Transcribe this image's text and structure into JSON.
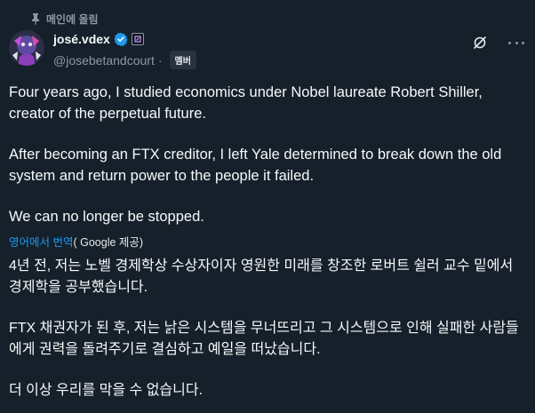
{
  "pinned": {
    "label": "메인에 올림",
    "icon": "pin-icon"
  },
  "author": {
    "display_name": "josé.vdex",
    "handle": "@josebetandcourt",
    "separator": "·",
    "member_badge": "멤버",
    "verified_color": "#1d9bf0"
  },
  "actions": {
    "grok_icon": "grok-icon",
    "more_icon": "more-icon"
  },
  "tweet": {
    "paragraphs": [
      "Four years ago, I studied economics under Nobel laureate Robert Shiller, creator of the perpetual future.",
      "After becoming an FTX creditor, I left Yale determined to break down the old system and return power to the people it failed.",
      "We can no longer be stopped."
    ]
  },
  "translation": {
    "link_label": "영어에서 번역",
    "provider_label": "( Google 제공)",
    "paragraphs": [
      "4년 전, 저는 노벨 경제학상 수상자이자 영원한 미래를 창조한 로버트 쉴러 교수 밑에서 경제학을 공부했습니다.",
      "FTX 채권자가 된 후, 저는 낡은 시스템을 무너뜨리고 그 시스템으로 인해 실패한 사람들에게 권력을 돌려주기로 결심하고 예일을 떠났습니다.",
      "더 이상 우리를 막을 수 없습니다."
    ]
  },
  "colors": {
    "background": "#15202b",
    "text": "#f7f9f9",
    "secondary": "#8b98a5",
    "link": "#1d9bf0"
  }
}
